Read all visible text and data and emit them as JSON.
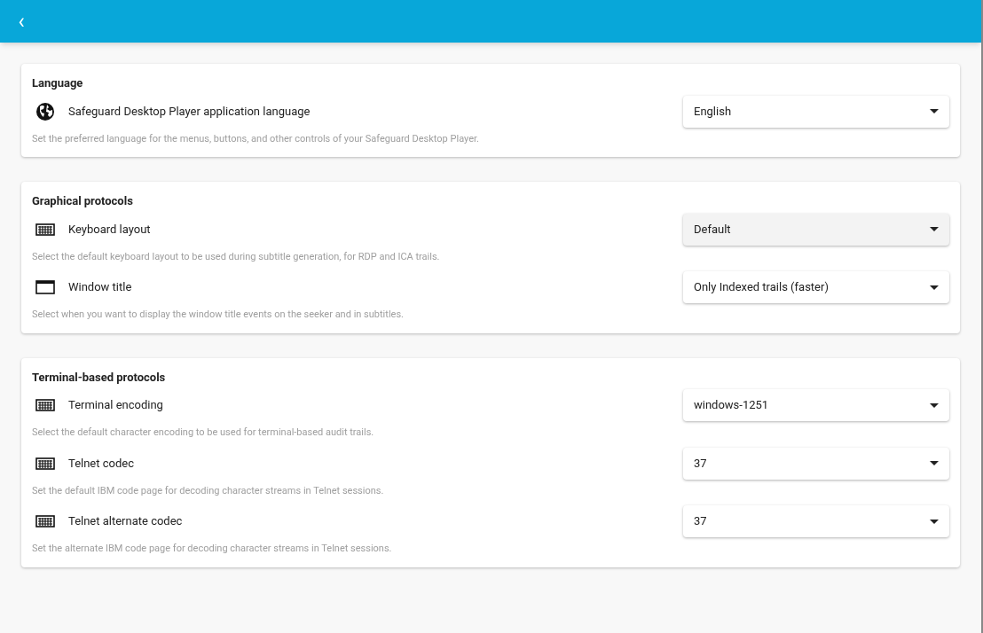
{
  "header": {
    "back": "‹"
  },
  "sections": [
    {
      "title": "Language",
      "settings": [
        {
          "kind": "globe",
          "label": "Safeguard Desktop Player application language",
          "value": "English",
          "highlighted": false,
          "description": "Set the preferred language for the menus, buttons, and other controls of your Safeguard Desktop Player."
        }
      ]
    },
    {
      "title": "Graphical protocols",
      "settings": [
        {
          "kind": "keyboard",
          "label": "Keyboard layout",
          "value": "Default",
          "highlighted": true,
          "description": "Select the default keyboard layout to be used during subtitle generation, for RDP and ICA trails."
        },
        {
          "kind": "window",
          "label": "Window title",
          "value": "Only Indexed trails (faster)",
          "highlighted": false,
          "description": "Select when you want to display the window title events on the seeker and in subtitles."
        }
      ]
    },
    {
      "title": "Terminal-based protocols",
      "settings": [
        {
          "kind": "keyboard",
          "label": "Terminal encoding",
          "value": "windows-1251",
          "highlighted": false,
          "description": "Select the default character encoding to be used for terminal-based audit trails."
        },
        {
          "kind": "keyboard",
          "label": "Telnet codec",
          "value": "37",
          "highlighted": false,
          "description": "Set the default IBM code page for decoding character streams in Telnet sessions."
        },
        {
          "kind": "keyboard",
          "label": "Telnet alternate codec",
          "value": "37",
          "highlighted": false,
          "description": "Set the alternate IBM code page for decoding character streams in Telnet sessions."
        }
      ]
    }
  ]
}
